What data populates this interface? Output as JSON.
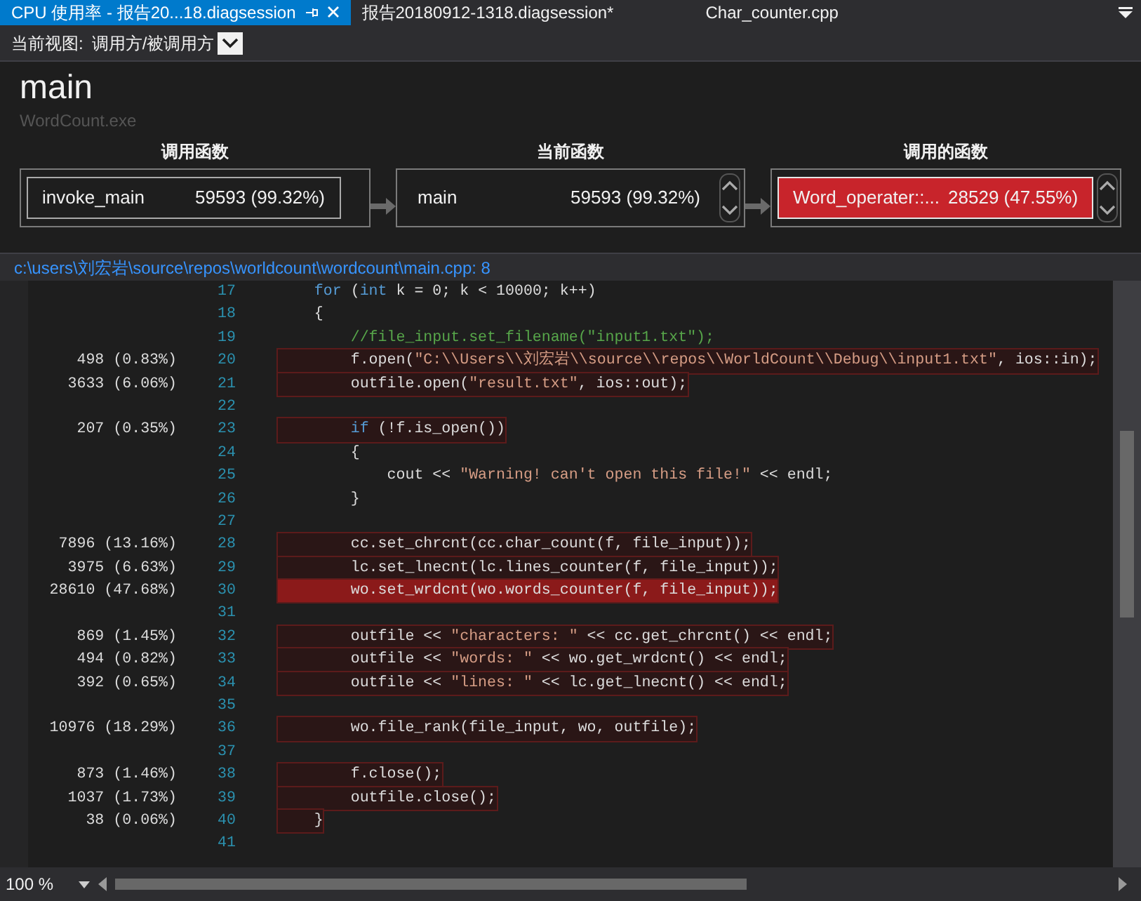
{
  "tabs": [
    {
      "label": "CPU 使用率 - 报告20...18.diagsession",
      "selected": true
    },
    {
      "label": "报告20180912-1318.diagsession*",
      "selected": false
    },
    {
      "label": "Char_counter.cpp",
      "selected": false
    }
  ],
  "view_selector": {
    "label": "当前视图:",
    "value": "调用方/被调用方"
  },
  "function": {
    "name": "main",
    "module": "WordCount.exe"
  },
  "panels": [
    {
      "title": "调用函数",
      "name": "invoke_main",
      "value": "59593 (99.32%)",
      "hot": false,
      "framed": true,
      "scrollable": false
    },
    {
      "title": "当前函数",
      "name": "main",
      "value": "59593 (99.32%)",
      "hot": false,
      "framed": false,
      "scrollable": true
    },
    {
      "title": "调用的函数",
      "name": "Word_operater::...",
      "value": "28529 (47.55%)",
      "hot": true,
      "framed": true,
      "scrollable": true
    }
  ],
  "source_path": "c:\\users\\刘宏岩\\source\\repos\\worldcount\\wordcount\\main.cpp: 8",
  "code_lines": [
    {
      "number": "17",
      "highlighted": false,
      "hot": false,
      "tokens": [
        {
          "kind": "kw",
          "text": "    for"
        },
        {
          "kind": "plain",
          "text": " ("
        },
        {
          "kind": "kw",
          "text": "int"
        },
        {
          "kind": "plain",
          "text": " k = 0; k < 10000; k++)"
        }
      ]
    },
    {
      "number": "18",
      "highlighted": false,
      "hot": false,
      "tokens": [
        {
          "kind": "plain",
          "text": "    {"
        }
      ]
    },
    {
      "number": "19",
      "highlighted": false,
      "hot": false,
      "tokens": [
        {
          "kind": "cmt",
          "text": "        //file_input.set_filename(\"input1.txt\");"
        }
      ]
    },
    {
      "number": "20",
      "samples": "498 (0.83%)",
      "highlighted": true,
      "hot": false,
      "tokens": [
        {
          "kind": "plain",
          "text": "        f.open("
        },
        {
          "kind": "str",
          "text": "\"C:\\\\Users\\\\刘宏岩\\\\source\\\\repos\\\\WorldCount\\\\Debug\\\\input1.txt\""
        },
        {
          "kind": "plain",
          "text": ", ios::in);"
        }
      ]
    },
    {
      "number": "21",
      "samples": "3633 (6.06%)",
      "highlighted": true,
      "hot": false,
      "tokens": [
        {
          "kind": "plain",
          "text": "        outfile.open("
        },
        {
          "kind": "str",
          "text": "\"result.txt\""
        },
        {
          "kind": "plain",
          "text": ", ios::out);"
        }
      ]
    },
    {
      "number": "22",
      "highlighted": false,
      "hot": false
    },
    {
      "number": "23",
      "samples": "207 (0.35%)",
      "highlighted": true,
      "hot": false,
      "tokens": [
        {
          "kind": "kw",
          "text": "        if"
        },
        {
          "kind": "plain",
          "text": " (!f.is_open())"
        }
      ]
    },
    {
      "number": "24",
      "highlighted": false,
      "hot": false,
      "tokens": [
        {
          "kind": "plain",
          "text": "        {"
        }
      ]
    },
    {
      "number": "25",
      "highlighted": false,
      "hot": false,
      "tokens": [
        {
          "kind": "plain",
          "text": "            cout << "
        },
        {
          "kind": "str",
          "text": "\"Warning! can't open this file!\""
        },
        {
          "kind": "plain",
          "text": " << endl;"
        }
      ]
    },
    {
      "number": "26",
      "highlighted": false,
      "hot": false,
      "tokens": [
        {
          "kind": "plain",
          "text": "        }"
        }
      ]
    },
    {
      "number": "27",
      "highlighted": false,
      "hot": false
    },
    {
      "number": "28",
      "samples": "7896 (13.16%)",
      "highlighted": true,
      "hot": false,
      "tokens": [
        {
          "kind": "plain",
          "text": "        cc.set_chrcnt(cc.char_count(f, file_input));"
        }
      ]
    },
    {
      "number": "29",
      "samples": "3975 (6.63%)",
      "highlighted": true,
      "hot": false,
      "tokens": [
        {
          "kind": "plain",
          "text": "        lc.set_lnecnt(lc.lines_counter(f, file_input));"
        }
      ]
    },
    {
      "number": "30",
      "samples": "28610 (47.68%)",
      "highlighted": true,
      "hot": true,
      "tokens": [
        {
          "kind": "plain",
          "text": "        wo.set_wrdcnt(wo.words_counter(f, file_input));"
        }
      ]
    },
    {
      "number": "31",
      "highlighted": false,
      "hot": false
    },
    {
      "number": "32",
      "samples": "869 (1.45%)",
      "highlighted": true,
      "hot": false,
      "tokens": [
        {
          "kind": "plain",
          "text": "        outfile << "
        },
        {
          "kind": "str",
          "text": "\"characters: \""
        },
        {
          "kind": "plain",
          "text": " << cc.get_chrcnt() << endl;"
        }
      ]
    },
    {
      "number": "33",
      "samples": "494 (0.82%)",
      "highlighted": true,
      "hot": false,
      "tokens": [
        {
          "kind": "plain",
          "text": "        outfile << "
        },
        {
          "kind": "str",
          "text": "\"words: \""
        },
        {
          "kind": "plain",
          "text": " << wo.get_wrdcnt() << endl;"
        }
      ]
    },
    {
      "number": "34",
      "samples": "392 (0.65%)",
      "highlighted": true,
      "hot": false,
      "tokens": [
        {
          "kind": "plain",
          "text": "        outfile << "
        },
        {
          "kind": "str",
          "text": "\"lines: \""
        },
        {
          "kind": "plain",
          "text": " << lc.get_lnecnt() << endl;"
        }
      ]
    },
    {
      "number": "35",
      "highlighted": false,
      "hot": false
    },
    {
      "number": "36",
      "samples": "10976 (18.29%)",
      "highlighted": true,
      "hot": false,
      "tokens": [
        {
          "kind": "plain",
          "text": "        wo.file_rank(file_input, wo, outfile);"
        }
      ]
    },
    {
      "number": "37",
      "highlighted": false,
      "hot": false
    },
    {
      "number": "38",
      "samples": "873 (1.46%)",
      "highlighted": true,
      "hot": false,
      "tokens": [
        {
          "kind": "plain",
          "text": "        f.close();"
        }
      ]
    },
    {
      "number": "39",
      "samples": "1037 (1.73%)",
      "highlighted": true,
      "hot": false,
      "tokens": [
        {
          "kind": "plain",
          "text": "        outfile.close();"
        }
      ]
    },
    {
      "number": "40",
      "samples": "38 (0.06%)",
      "highlighted": true,
      "hot": false,
      "tokens": [
        {
          "kind": "plain",
          "text": "    }"
        }
      ]
    },
    {
      "number": "41",
      "highlighted": false,
      "hot": false
    }
  ],
  "zoom": "100 %"
}
